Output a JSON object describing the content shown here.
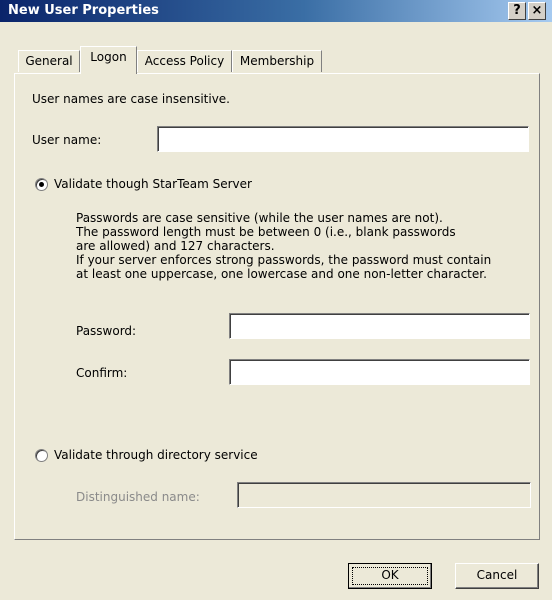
{
  "window": {
    "title": "New User Properties",
    "help_label": "?",
    "close_label": "×"
  },
  "tabs": [
    {
      "label": "General"
    },
    {
      "label": "Logon",
      "active": true
    },
    {
      "label": "Access Policy"
    },
    {
      "label": "Membership"
    }
  ],
  "logon": {
    "case_note": "User names are case insensitive.",
    "username_label": "User name:",
    "username_value": "",
    "validate_server_label": "Validate though StarTeam Server",
    "validate_server_selected": true,
    "password_note": "Passwords are case sensitive (while the user names are not).\nThe password length must be between 0 (i.e., blank passwords\nare allowed) and 127 characters.\nIf your server enforces strong passwords, the password must contain\nat least one uppercase, one lowercase and one non-letter character.",
    "password_label": "Password:",
    "password_value": "",
    "confirm_label": "Confirm:",
    "confirm_value": "",
    "validate_directory_label": "Validate through directory service",
    "validate_directory_selected": false,
    "distinguished_name_label": "Distinguished name:",
    "distinguished_name_value": ""
  },
  "buttons": {
    "ok": "OK",
    "cancel": "Cancel"
  }
}
